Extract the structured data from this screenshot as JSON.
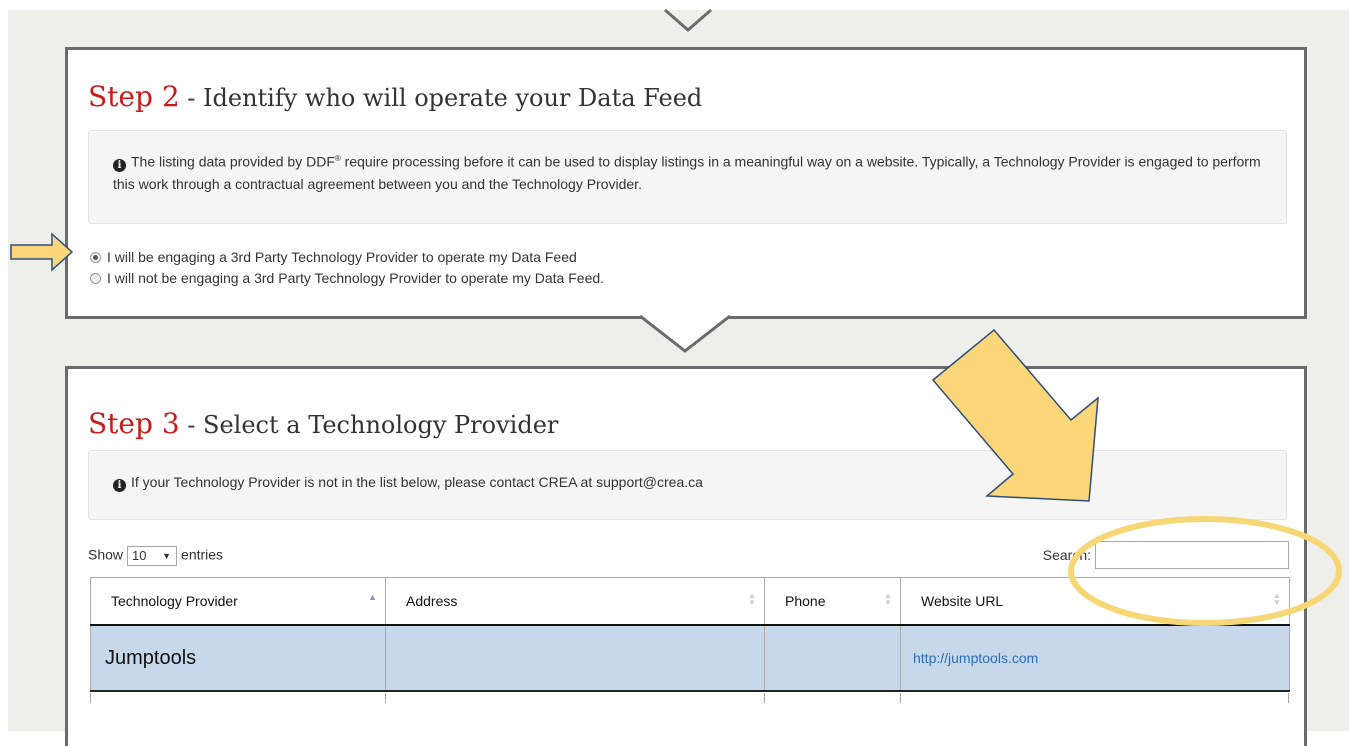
{
  "step2": {
    "step_label": "Step 2",
    "title": " - Identify who will operate your Data Feed",
    "info_text_before": "The listing data provided by DDF",
    "info_sup": "®",
    "info_text_after": " require processing before it can be used to display listings in a meaningful way on a website. Typically, a Technology Provider is engaged to perform this work through a contractual agreement between you and the Technology Provider.",
    "options": [
      {
        "label": "I will be engaging a 3rd Party Technology Provider to operate my Data Feed",
        "selected": true
      },
      {
        "label": "I will not be engaging a 3rd Party Technology Provider to operate my Data Feed.",
        "selected": false
      }
    ]
  },
  "step3": {
    "step_label": "Step 3",
    "title": " - Select a Technology Provider",
    "info_text": "If your Technology Provider is not in the list below, please contact CREA at support@crea.ca",
    "show_label": "Show",
    "entries_value": "10",
    "entries_label": "entries",
    "search_label": "Search:",
    "search_value": "",
    "columns": [
      "Technology Provider",
      "Address",
      "Phone",
      "Website URL"
    ],
    "rows": [
      {
        "provider": "Jumptools",
        "address": "",
        "phone": "",
        "website": "http://jumptools.com"
      }
    ]
  },
  "annotations": {
    "arrow_color": "#fcd77a",
    "arrow_stroke": "#2f4d7a",
    "ellipse_color": "#f7d675"
  }
}
